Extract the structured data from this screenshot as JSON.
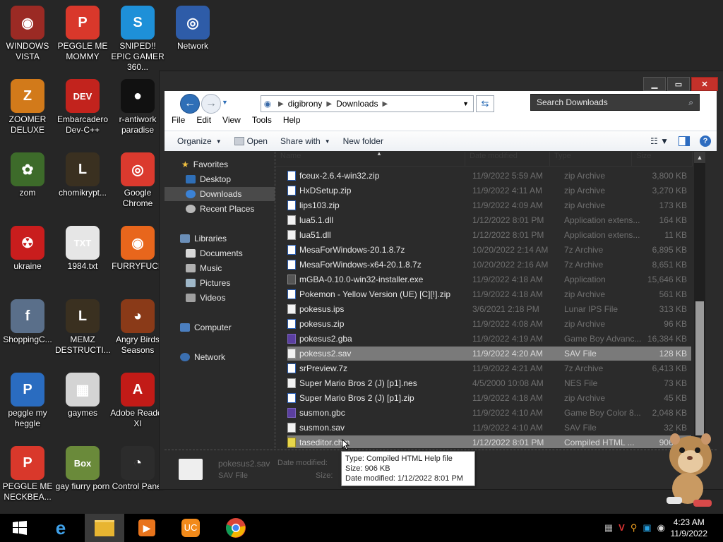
{
  "desktop": {
    "icons": [
      {
        "label": "WINDOWS VISTA",
        "color": "#9b2a24",
        "glyph": "◉",
        "icon": "windows-vista-icon"
      },
      {
        "label": "PEGGLE ME MOMMY",
        "color": "#d9382b",
        "glyph": "P",
        "icon": "peggle-icon"
      },
      {
        "label": "SNIPED!! EPIC GAMER 360...",
        "color": "#1e90d8",
        "glyph": "S",
        "icon": "skype-icon"
      },
      {
        "label": "Network",
        "color": "#2e5ca8",
        "glyph": "◎",
        "icon": "network-globe-icon"
      },
      {
        "label": "ZOOMER DELUXE",
        "color": "#d27a1a",
        "glyph": "Z",
        "icon": "zoomer-icon"
      },
      {
        "label": "Embarcadero Dev-C++",
        "color": "#c2231d",
        "glyph": "DEV",
        "icon": "devcpp-icon"
      },
      {
        "label": "r-antiwork paradise",
        "color": "#111111",
        "glyph": "●",
        "icon": "antiwork-icon"
      },
      {
        "label": "zom",
        "color": "#3d6b2a",
        "glyph": "✿",
        "icon": "flower-icon"
      },
      {
        "label": "chomikrypt...",
        "color": "#3a3020",
        "glyph": "L",
        "icon": "lock-app-icon"
      },
      {
        "label": "Google Chrome",
        "color": "#db3a2e",
        "glyph": "◎",
        "icon": "chrome-icon"
      },
      {
        "label": "ukraine",
        "color": "#c91d1d",
        "glyph": "☢",
        "icon": "radiation-icon"
      },
      {
        "label": "1984.txt",
        "color": "#e6e6e6",
        "glyph": "TXT",
        "icon": "text-file-icon"
      },
      {
        "label": "FURRYFUCK",
        "color": "#e8661c",
        "glyph": "◉",
        "icon": "firefox-icon"
      },
      {
        "label": "ShoppingC...",
        "color": "#5a6f8a",
        "glyph": "f",
        "icon": "flash-icon"
      },
      {
        "label": "MEMZ DESTRUCTI...",
        "color": "#3a3020",
        "glyph": "L",
        "icon": "lock-app-icon"
      },
      {
        "label": "Angry Birds Seasons",
        "color": "#8a3a18",
        "glyph": "◕",
        "icon": "angry-birds-icon"
      },
      {
        "label": "peggle my heggle",
        "color": "#2a6cc0",
        "glyph": "P",
        "icon": "peggle-icon"
      },
      {
        "label": "gaymes",
        "color": "#d4d4d4",
        "glyph": "▦",
        "icon": "folder-icon"
      },
      {
        "label": "Adobe Reader XI",
        "color": "#c21b17",
        "glyph": "A",
        "icon": "adobe-reader-icon"
      },
      {
        "label": "PEGGLE ME NECKBEA...",
        "color": "#d9382b",
        "glyph": "P",
        "icon": "peggle-icon"
      },
      {
        "label": "gay fiurry porn",
        "color": "#6a8a3a",
        "glyph": "Box",
        "icon": "box-game-icon"
      },
      {
        "label": "Control Panel",
        "color": "#2c2c2c",
        "glyph": "◔",
        "icon": "control-panel-icon"
      }
    ]
  },
  "window": {
    "controls": {
      "minimize": "▁",
      "maximize": "▭",
      "close": "✕"
    },
    "address": {
      "root": "digibrony",
      "folder": "Downloads"
    },
    "search_placeholder": "Search Downloads",
    "menu": [
      "File",
      "Edit",
      "View",
      "Tools",
      "Help"
    ],
    "toolbar": {
      "organize": "Organize",
      "open": "Open",
      "share": "Share with",
      "new_folder": "New folder"
    },
    "nav": {
      "favorites": "Favorites",
      "desktop": "Desktop",
      "downloads": "Downloads",
      "recent": "Recent Places",
      "libraries": "Libraries",
      "documents": "Documents",
      "music": "Music",
      "pictures": "Pictures",
      "videos": "Videos",
      "computer": "Computer",
      "network": "Network"
    },
    "columns": [
      "Name",
      "Date modified",
      "Type",
      "Size"
    ],
    "files": [
      {
        "name": "fceux-2.6.4-win32.zip",
        "date": "11/9/2022 5:59 AM",
        "type": "zip Archive",
        "size": "3,800 KB",
        "kind": "zip"
      },
      {
        "name": "HxDSetup.zip",
        "date": "11/9/2022 4:11 AM",
        "type": "zip Archive",
        "size": "3,270 KB",
        "kind": "zip"
      },
      {
        "name": "lips103.zip",
        "date": "11/9/2022 4:09 AM",
        "type": "zip Archive",
        "size": "173 KB",
        "kind": "zip"
      },
      {
        "name": "lua5.1.dll",
        "date": "1/12/2022 8:01 PM",
        "type": "Application extens...",
        "size": "164 KB",
        "kind": "dll"
      },
      {
        "name": "lua51.dll",
        "date": "1/12/2022 8:01 PM",
        "type": "Application extens...",
        "size": "11 KB",
        "kind": "dll"
      },
      {
        "name": "MesaForWindows-20.1.8.7z",
        "date": "10/20/2022 2:14 AM",
        "type": "7z Archive",
        "size": "6,895 KB",
        "kind": "zip"
      },
      {
        "name": "MesaForWindows-x64-20.1.8.7z",
        "date": "10/20/2022 2:16 AM",
        "type": "7z Archive",
        "size": "8,651 KB",
        "kind": "zip"
      },
      {
        "name": "mGBA-0.10.0-win32-installer.exe",
        "date": "11/9/2022 4:18 AM",
        "type": "Application",
        "size": "15,646 KB",
        "kind": "exe"
      },
      {
        "name": "Pokemon - Yellow Version (UE) [C][!].zip",
        "date": "11/9/2022 4:18 AM",
        "type": "zip Archive",
        "size": "561 KB",
        "kind": "zip"
      },
      {
        "name": "pokesus.ips",
        "date": "3/6/2021 2:18 PM",
        "type": "Lunar IPS File",
        "size": "313 KB",
        "kind": "dll"
      },
      {
        "name": "pokesus.zip",
        "date": "11/9/2022 4:08 AM",
        "type": "zip Archive",
        "size": "96 KB",
        "kind": "zip"
      },
      {
        "name": "pokesus2.gba",
        "date": "11/9/2022 4:19 AM",
        "type": "Game Boy Advanc...",
        "size": "16,384 KB",
        "kind": "gba"
      },
      {
        "name": "pokesus2.sav",
        "date": "11/9/2022 4:20 AM",
        "type": "SAV File",
        "size": "128 KB",
        "kind": "dll",
        "selected": true
      },
      {
        "name": "srPreview.7z",
        "date": "11/9/2022 4:21 AM",
        "type": "7z Archive",
        "size": "6,413 KB",
        "kind": "zip"
      },
      {
        "name": "Super Mario Bros 2 (J) [p1].nes",
        "date": "4/5/2000 10:08 AM",
        "type": "NES File",
        "size": "73 KB",
        "kind": "dll"
      },
      {
        "name": "Super Mario Bros 2 (J) [p1].zip",
        "date": "11/9/2022 4:18 AM",
        "type": "zip Archive",
        "size": "45 KB",
        "kind": "zip"
      },
      {
        "name": "susmon.gbc",
        "date": "11/9/2022 4:10 AM",
        "type": "Game Boy Color 8...",
        "size": "2,048 KB",
        "kind": "gba"
      },
      {
        "name": "susmon.sav",
        "date": "11/9/2022 4:10 AM",
        "type": "SAV File",
        "size": "32 KB",
        "kind": "dll"
      },
      {
        "name": "taseditor.chm",
        "date": "1/12/2022 8:01 PM",
        "type": "Compiled HTML ...",
        "size": "906 KB",
        "kind": "chm",
        "hover": true
      }
    ],
    "details": {
      "name": "pokesus2.sav",
      "type": "SAV File",
      "date_label": "Date modified:",
      "size_label": "Size:"
    }
  },
  "tooltip": {
    "type": "Type: Compiled HTML Help file",
    "size": "Size: 906 KB",
    "date": "Date modified: 1/12/2022 8:01 PM"
  },
  "taskbar": {
    "time": "4:23 AM",
    "date": "11/9/2022"
  },
  "colors": {
    "selection": "#7a7a7a",
    "accent": "#2f6fb7",
    "close": "#c4312a"
  }
}
